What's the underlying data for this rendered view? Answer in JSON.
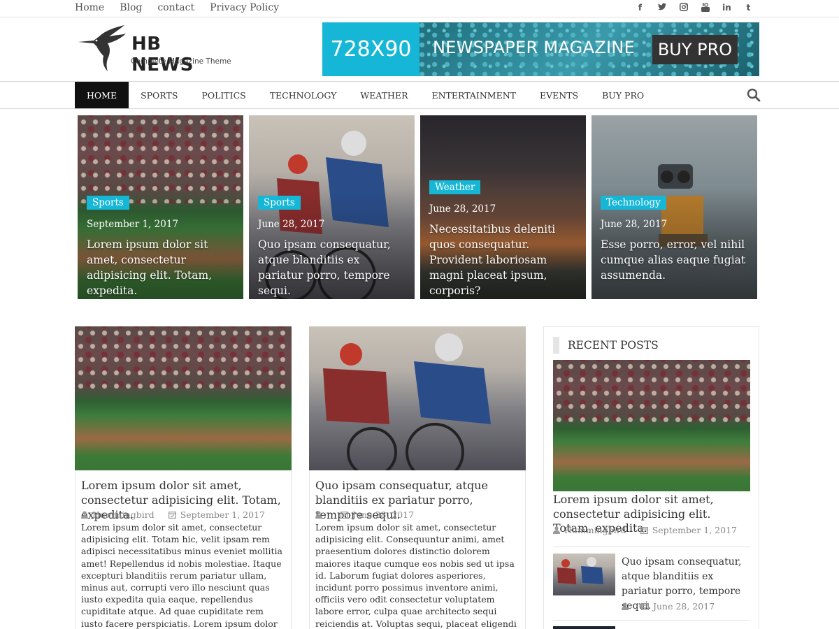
{
  "topbar": {
    "links": [
      "Home",
      "Blog",
      "contact",
      "Privacy Policy"
    ],
    "social": [
      "f",
      "t",
      "ig",
      "yt",
      "in",
      "t"
    ]
  },
  "logo": {
    "title": "HB NEWS",
    "subtitle": "Complete Magazine Theme"
  },
  "banner": {
    "size": "728X90",
    "label": "NEWSPAPER MAGAZINE",
    "cta": "BUY PRO"
  },
  "nav": {
    "items": [
      "HOME",
      "SPORTS",
      "POLITICS",
      "TECHNOLOGY",
      "WEATHER",
      "ENTERTAINMENT",
      "EVENTS",
      "BUY PRO"
    ],
    "active": "HOME"
  },
  "featured": [
    {
      "category": "Sports",
      "date": "September 1, 2017",
      "title": "Lorem ipsum dolor sit amet, consectetur adipisicing elit. Totam, expedita."
    },
    {
      "category": "Sports",
      "date": "June 28, 2017",
      "title": "Quo ipsam consequatur, atque blanditiis ex pariatur porro, tempore sequi."
    },
    {
      "category": "Weather",
      "date": "June 28, 2017",
      "title": "Necessitatibus deleniti quos consequatur. Provident laboriosam magni placeat ipsum, corporis?"
    },
    {
      "category": "Technology",
      "date": "June 28, 2017",
      "title": "Esse porro, error, vel nihil cumque alias eaque fugiat assumenda."
    }
  ],
  "posts": [
    {
      "title": "Lorem ipsum dolor sit amet, consectetur adipisicing elit. Totam, expedita.",
      "author": "Hummingbird",
      "date": "September 1, 2017",
      "excerpt": "Lorem ipsum dolor sit amet, consectetur adipisicing elit. Totam hic, velit ipsam rem adipisci necessitatibus minus eveniet mollitia amet! Repellendus id nobis molestiae. Itaque excepturi blanditiis rerum pariatur ullam, minus aut, corrupti vero illo nesciunt quas iusto expedita quia eaque, repellendus cupiditate atque. Ad quae cupiditate rem iusto facere perspiciatis. Lorem ipsum dolor sit amet, [...]"
    },
    {
      "title": "Quo ipsam consequatur, atque blanditiis ex pariatur porro, tempore sequi.",
      "author": "",
      "date": "June 28, 2017",
      "excerpt": "Lorem ipsum dolor sit amet, consectetur adipisicing elit. Consequuntur animi, amet praesentium dolores distinctio dolorem maiores itaque cumque eos nobis sed ut ipsa id. Laborum fugiat dolores asperiores, incidunt porro possimus inventore animi, officiis vero odit consectetur voluptatem labore error, culpa quae architecto sequi reiciendis at. Voluptas sequi, placeat eligendi fuga reprehenderit alias facere, reiciendis [...]"
    }
  ],
  "sidebar": {
    "title": "RECENT POSTS",
    "main_post": {
      "title": "Lorem ipsum dolor sit amet, consectetur adipisicing elit. Totam, expedita.",
      "author": "Hummingbird",
      "date": "September 1, 2017"
    },
    "small_post": {
      "title": "Quo ipsam consequatur, atque blanditiis ex pariatur porro, tempore sequi.",
      "date": "June 28, 2017"
    }
  },
  "colors": {
    "accent": "#16b7d6",
    "nav_active": "#111111",
    "text": "#333333",
    "meta": "#888888"
  },
  "icons": [
    "facebook-icon",
    "twitter-icon",
    "instagram-icon",
    "youtube-icon",
    "linkedin-icon",
    "tumblr-icon",
    "search-icon",
    "user-icon",
    "calendar-icon",
    "hummingbird-logo"
  ]
}
